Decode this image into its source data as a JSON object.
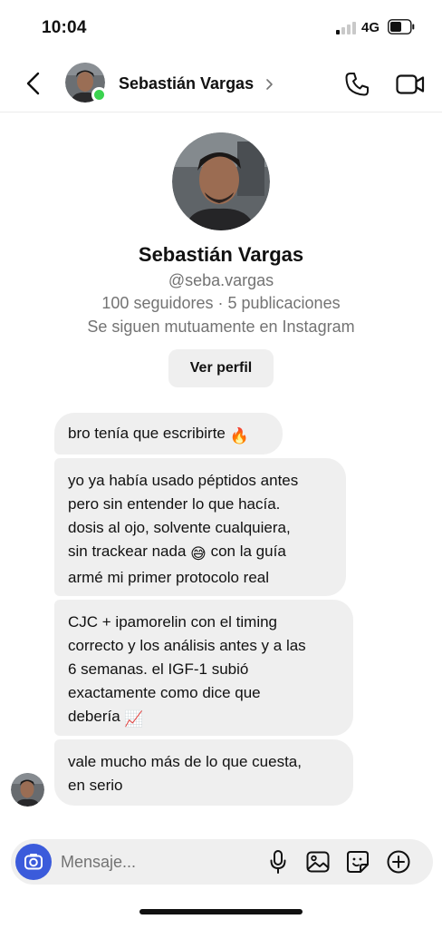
{
  "status_bar": {
    "time": "10:04",
    "network": "4G",
    "signal_icon": "signal-bars-icon",
    "battery_icon": "battery-icon"
  },
  "header": {
    "contact_name": "Sebastián Vargas",
    "online": true,
    "online_color": "#3ad34f",
    "icons": [
      "back-arrow-icon",
      "chevron-right-icon",
      "phone-icon",
      "video-camera-icon"
    ]
  },
  "profile": {
    "name": "Sebastián Vargas",
    "handle": "@seba.vargas",
    "stats": "100 seguidores · 5 publicaciones",
    "mutual": "Se siguen mutuamente en Instagram",
    "view_profile_label": "Ver perfil"
  },
  "messages": [
    {
      "text": "bro tenía que escribirte",
      "emoji": "🔥"
    },
    {
      "text": "yo ya había usado péptidos antes\npero sin entender lo que hacía.\ndosis al ojo, solvente cualquiera,\nsin trackear nada",
      "emoji": "😅",
      "text_after": " con la guía\narmé mi primer protocolo real"
    },
    {
      "text": "CJC + ipamorelin con el timing\ncorrecto y los análisis antes y a las\n6 semanas. el IGF-1 subió\nexactamente como dice que\ndebería",
      "emoji": "📈"
    },
    {
      "text": " vale mucho más de lo que cuesta,\nen serio"
    }
  ],
  "composer": {
    "placeholder": "Mensaje...",
    "camera_color": "#3b5bdb",
    "icons": [
      "camera-icon",
      "microphone-icon",
      "gallery-icon",
      "sticker-icon",
      "plus-circle-icon"
    ]
  },
  "colors": {
    "bubble_bg": "#efefef",
    "secondary_text": "#737373"
  }
}
